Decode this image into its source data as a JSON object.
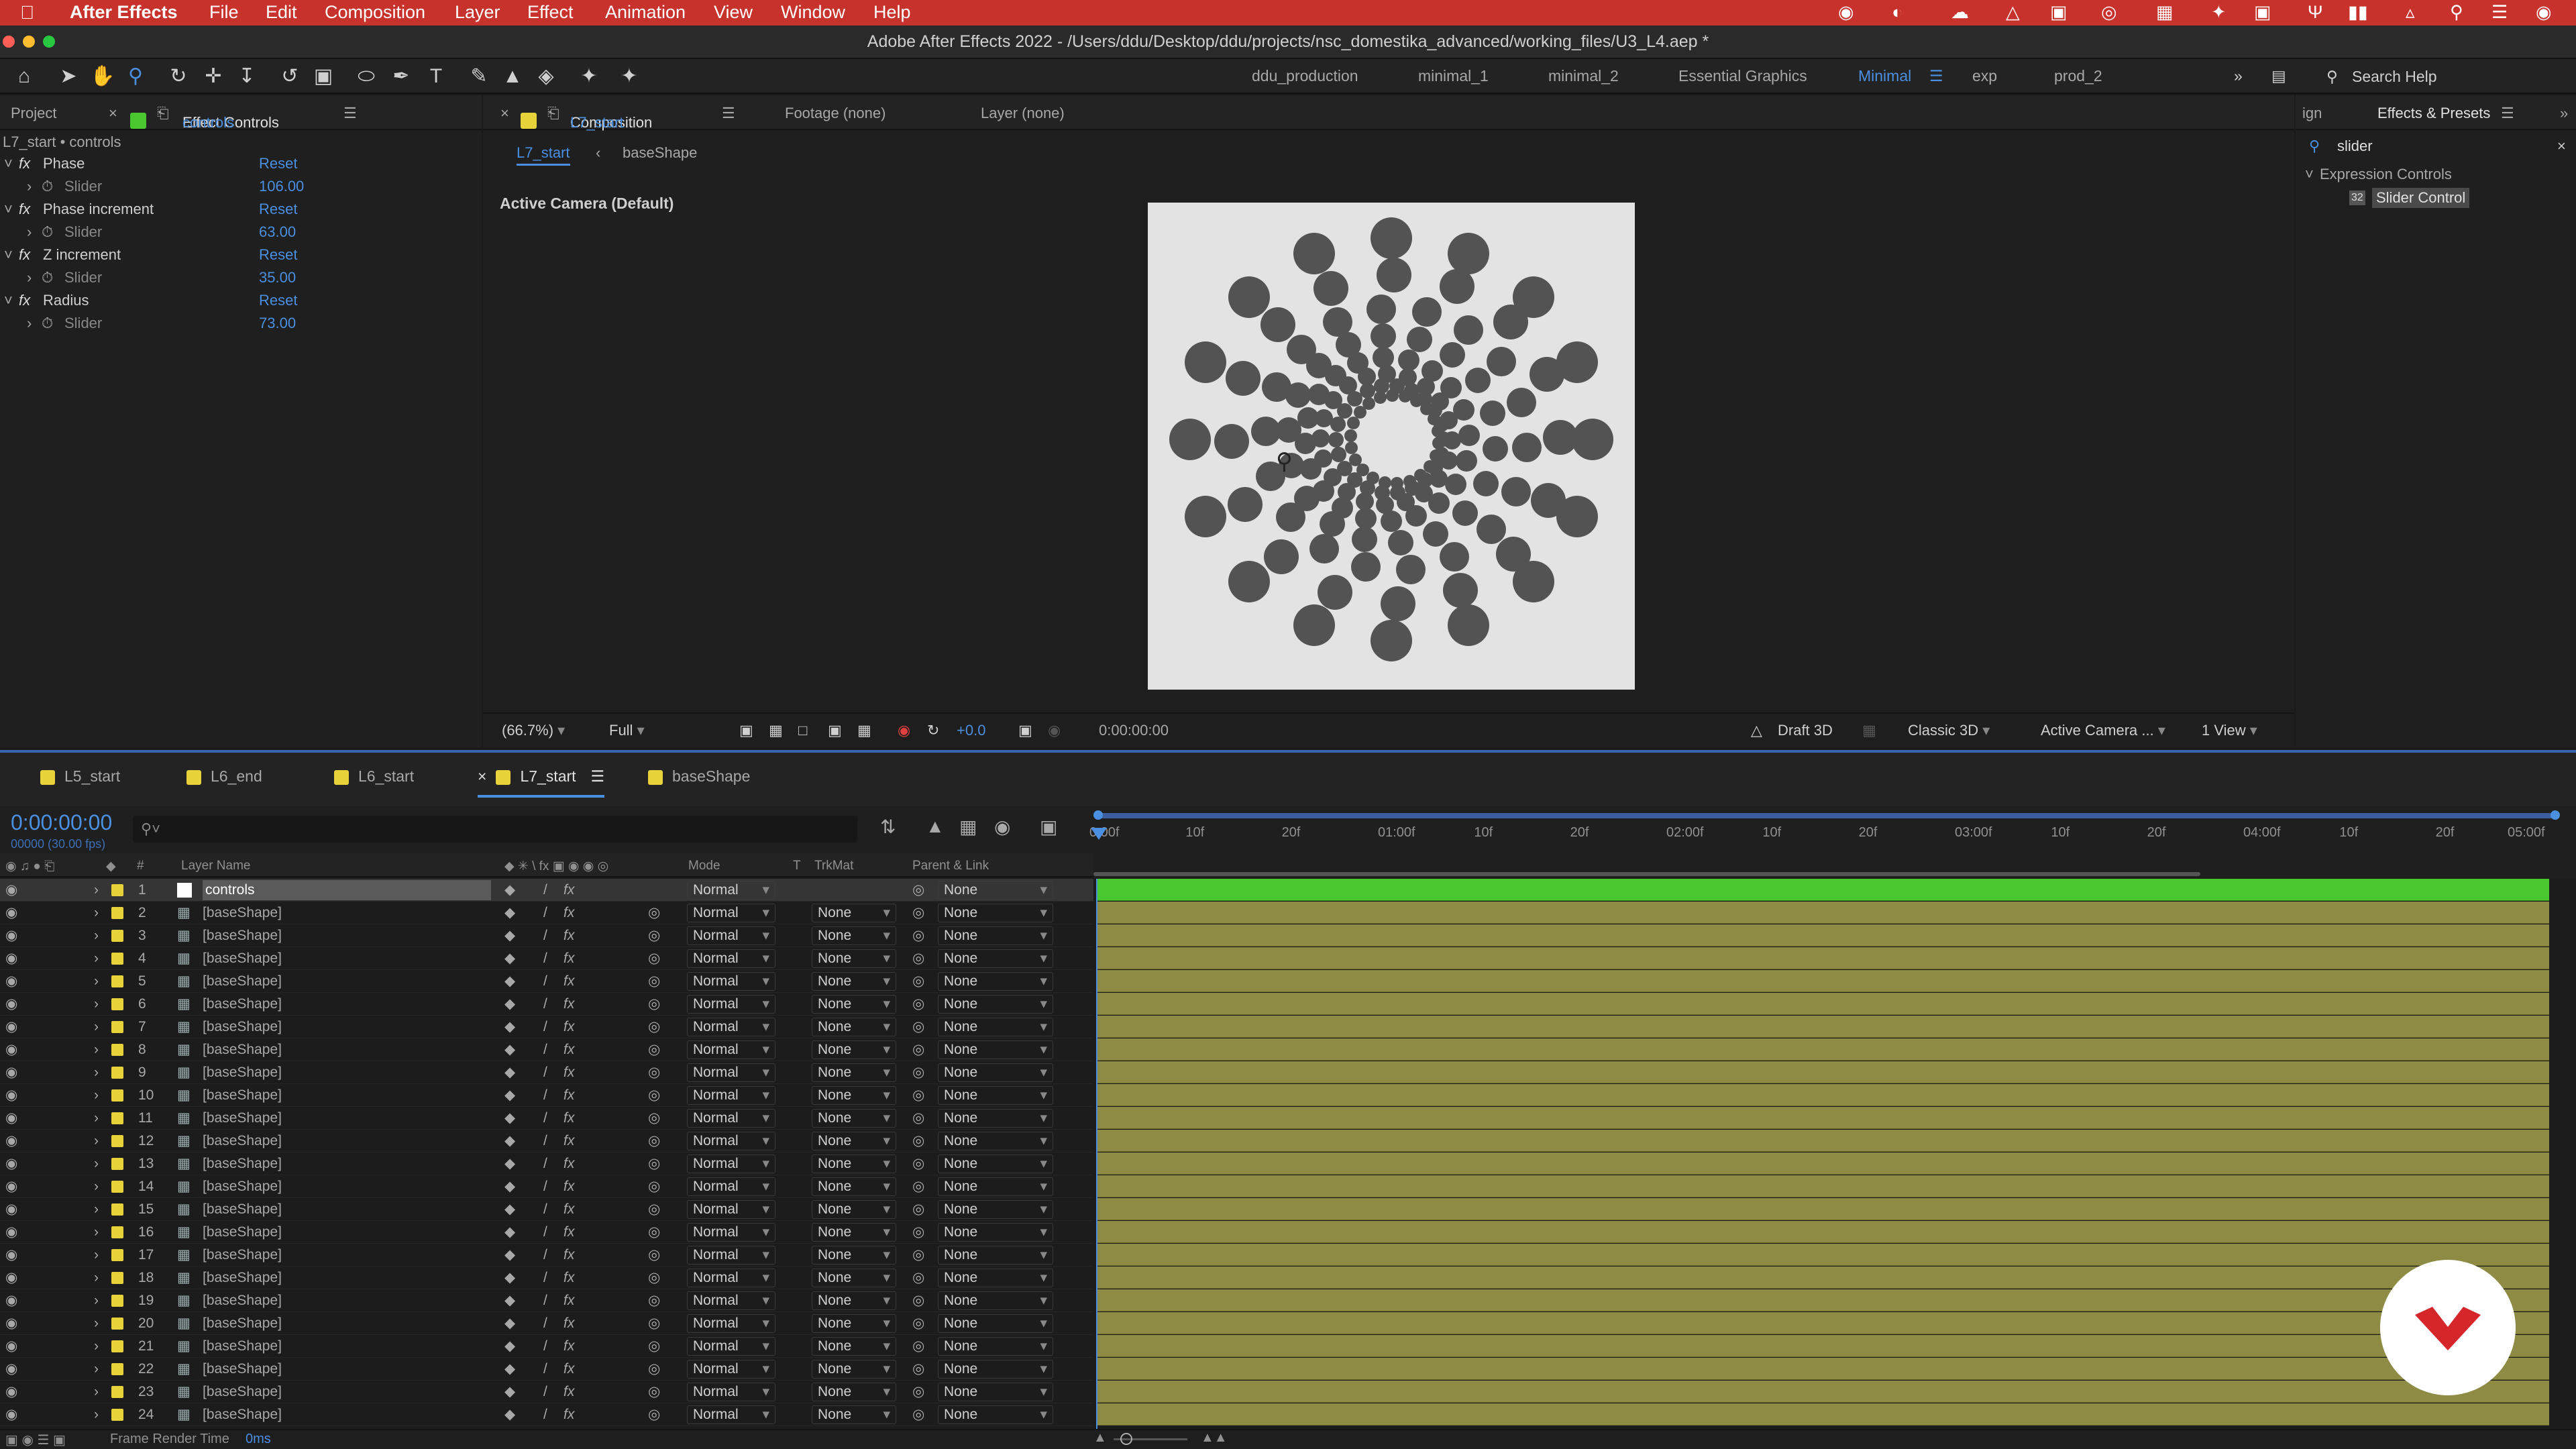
{
  "menubar": {
    "app": "After Effects",
    "items": [
      "File",
      "Edit",
      "Composition",
      "Layer",
      "Effect",
      "Animation",
      "View",
      "Window",
      "Help"
    ]
  },
  "titlebar": {
    "title": "Adobe After Effects 2022 - /Users/ddu/Desktop/ddu/projects/nsc_domestika_advanced/working_files/U3_L4.aep *"
  },
  "workspaces": {
    "items": [
      "ddu_production",
      "minimal_1",
      "minimal_2",
      "Essential Graphics",
      "Minimal",
      "exp",
      "prod_2"
    ],
    "active": "Minimal"
  },
  "search_help": {
    "placeholder": "Search Help"
  },
  "project_panel": {
    "project_tab": "Project",
    "effect_controls_tab": "Effect Controls",
    "effect_controls_layer": "controls",
    "breadcrumb": "L7_start • controls",
    "effects": [
      {
        "name": "Phase",
        "reset": "Reset",
        "param": "Slider",
        "value": "106.00"
      },
      {
        "name": "Phase increment",
        "reset": "Reset",
        "param": "Slider",
        "value": "63.00"
      },
      {
        "name": "Z increment",
        "reset": "Reset",
        "param": "Slider",
        "value": "35.00"
      },
      {
        "name": "Radius",
        "reset": "Reset",
        "param": "Slider",
        "value": "73.00"
      }
    ]
  },
  "viewer": {
    "composition_tab": "Composition",
    "composition_name": "L7_start",
    "footage_tab": "Footage (none)",
    "layer_tab": "Layer (none)",
    "breadcrumb_current": "L7_start",
    "breadcrumb_next": "baseShape",
    "camera_label": "Active Camera (Default)",
    "zoom": "(66.7%)",
    "resolution": "Full",
    "exposure": "+0.0",
    "timecode": "0:00:00:00",
    "draft3d": "Draft 3D",
    "renderer": "Classic 3D",
    "camera": "Active Camera ...",
    "views": "1 View"
  },
  "effects_presets": {
    "partial_tab": "ign",
    "tab": "Effects & Presets",
    "search_value": "slider",
    "category": "Expression Controls",
    "item": "Slider Control"
  },
  "timeline_tabs": {
    "items": [
      {
        "label": "L5_start",
        "color": "#e8d23b"
      },
      {
        "label": "L6_end",
        "color": "#e8d23b"
      },
      {
        "label": "L6_start",
        "color": "#e8d23b"
      },
      {
        "label": "L7_start",
        "color": "#e8d23b"
      },
      {
        "label": "baseShape",
        "color": "#e8d23b"
      }
    ],
    "active": "L7_start"
  },
  "timeline": {
    "timecode": "0:00:00:00",
    "fps": "00000 (30.00 fps)",
    "columns": {
      "layer_name": "Layer Name",
      "mode": "Mode",
      "t": "T",
      "trkmat": "TrkMat",
      "parent": "Parent & Link"
    },
    "ruler": [
      "0:00f",
      "10f",
      "20f",
      "01:00f",
      "10f",
      "20f",
      "02:00f",
      "10f",
      "20f",
      "03:00f",
      "10f",
      "20f",
      "04:00f",
      "10f",
      "20f",
      "05:00f"
    ],
    "layers": [
      {
        "num": "1",
        "name": "controls",
        "mode": "Normal",
        "trkmat": "",
        "parent": "None"
      },
      {
        "num": "2",
        "name": "[baseShape]",
        "mode": "Normal",
        "trkmat": "None",
        "parent": "None"
      },
      {
        "num": "3",
        "name": "[baseShape]",
        "mode": "Normal",
        "trkmat": "None",
        "parent": "None"
      },
      {
        "num": "4",
        "name": "[baseShape]",
        "mode": "Normal",
        "trkmat": "None",
        "parent": "None"
      },
      {
        "num": "5",
        "name": "[baseShape]",
        "mode": "Normal",
        "trkmat": "None",
        "parent": "None"
      },
      {
        "num": "6",
        "name": "[baseShape]",
        "mode": "Normal",
        "trkmat": "None",
        "parent": "None"
      },
      {
        "num": "7",
        "name": "[baseShape]",
        "mode": "Normal",
        "trkmat": "None",
        "parent": "None"
      },
      {
        "num": "8",
        "name": "[baseShape]",
        "mode": "Normal",
        "trkmat": "None",
        "parent": "None"
      },
      {
        "num": "9",
        "name": "[baseShape]",
        "mode": "Normal",
        "trkmat": "None",
        "parent": "None"
      },
      {
        "num": "10",
        "name": "[baseShape]",
        "mode": "Normal",
        "trkmat": "None",
        "parent": "None"
      },
      {
        "num": "11",
        "name": "[baseShape]",
        "mode": "Normal",
        "trkmat": "None",
        "parent": "None"
      },
      {
        "num": "12",
        "name": "[baseShape]",
        "mode": "Normal",
        "trkmat": "None",
        "parent": "None"
      },
      {
        "num": "13",
        "name": "[baseShape]",
        "mode": "Normal",
        "trkmat": "None",
        "parent": "None"
      },
      {
        "num": "14",
        "name": "[baseShape]",
        "mode": "Normal",
        "trkmat": "None",
        "parent": "None"
      },
      {
        "num": "15",
        "name": "[baseShape]",
        "mode": "Normal",
        "trkmat": "None",
        "parent": "None"
      },
      {
        "num": "16",
        "name": "[baseShape]",
        "mode": "Normal",
        "trkmat": "None",
        "parent": "None"
      },
      {
        "num": "17",
        "name": "[baseShape]",
        "mode": "Normal",
        "trkmat": "None",
        "parent": "None"
      },
      {
        "num": "18",
        "name": "[baseShape]",
        "mode": "Normal",
        "trkmat": "None",
        "parent": "None"
      },
      {
        "num": "19",
        "name": "[baseShape]",
        "mode": "Normal",
        "trkmat": "None",
        "parent": "None"
      },
      {
        "num": "20",
        "name": "[baseShape]",
        "mode": "Normal",
        "trkmat": "None",
        "parent": "None"
      },
      {
        "num": "21",
        "name": "[baseShape]",
        "mode": "Normal",
        "trkmat": "None",
        "parent": "None"
      },
      {
        "num": "22",
        "name": "[baseShape]",
        "mode": "Normal",
        "trkmat": "None",
        "parent": "None"
      },
      {
        "num": "23",
        "name": "[baseShape]",
        "mode": "Normal",
        "trkmat": "None",
        "parent": "None"
      },
      {
        "num": "24",
        "name": "[baseShape]",
        "mode": "Normal",
        "trkmat": "None",
        "parent": "None"
      }
    ]
  },
  "statusbar": {
    "label": "Frame Render Time",
    "value": "0ms"
  },
  "colors": {
    "accent": "#4a8fe0",
    "menubar": "#c8322c",
    "layer_label": "#e8d23b",
    "controls_bar": "#49c72e",
    "shape_bar": "#8e8b44"
  }
}
